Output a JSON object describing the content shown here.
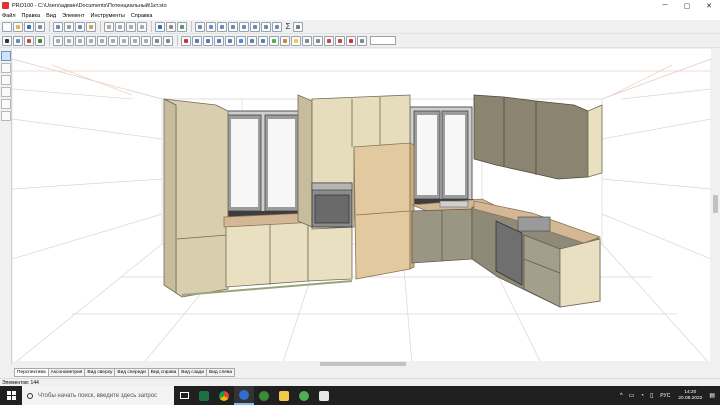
{
  "window": {
    "title": "PRO100 - C:\\Users\\админ\\Documents\\Потенциальный\\1кт.sto",
    "controls": {
      "minimize": "─",
      "maximize": "▢",
      "close": "✕"
    }
  },
  "menu": [
    "Файл",
    "Правка",
    "Вид",
    "Элемент",
    "Инструменты",
    "Справка"
  ],
  "toolbar": {
    "sigma": "Σ"
  },
  "view_tabs": [
    "Перспектива",
    "Аксонометрия",
    "Вид сверху",
    "Вид спереди",
    "Вид справа",
    "Вид сзади",
    "Вид слева"
  ],
  "status": {
    "elements": "Элементов: 144"
  },
  "taskbar": {
    "search_placeholder": "Чтобы начать поиск, введите здесь запрос",
    "apps": [
      "task-view-icon",
      "excel-icon",
      "chrome-icon",
      "pro100-icon",
      "pro100-alt-icon",
      "file-explorer-icon",
      "settings-icon",
      "calendar-icon"
    ],
    "tray": {
      "chevron": "^",
      "language": "РУС",
      "time": "14:20",
      "date": "20.08.2022"
    }
  },
  "colors": {
    "cabinet_cream": "#e8dfbf",
    "cabinet_olive": "#8a8470",
    "wood": "#e2c9a0",
    "countertop": "#d4b896",
    "taskbar": "#202020"
  }
}
